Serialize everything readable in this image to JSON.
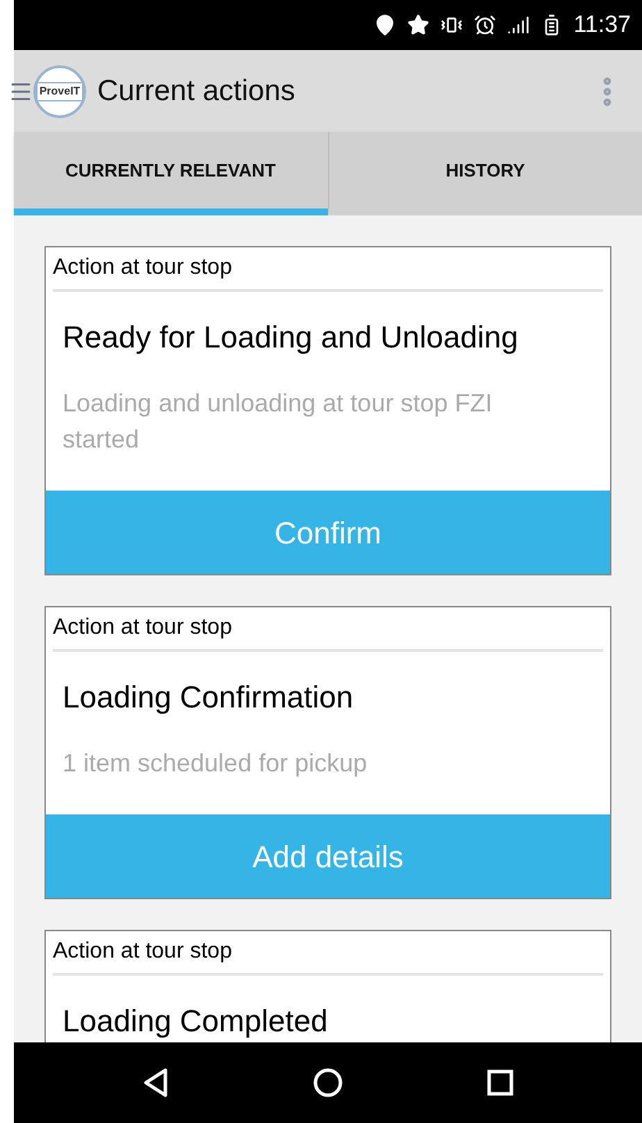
{
  "status_bar": {
    "time": "11:37"
  },
  "app_bar": {
    "logo_text": "ProveIT",
    "title": "Current actions"
  },
  "tabs": [
    {
      "label": "CURRENTLY RELEVANT",
      "selected": true
    },
    {
      "label": "HISTORY",
      "selected": false
    }
  ],
  "cards": [
    {
      "header": "Action at tour stop",
      "title": "Ready for Loading and Unloading",
      "description": "Loading and unloading at tour stop FZI started",
      "button": "Confirm"
    },
    {
      "header": "Action at tour stop",
      "title": "Loading Confirmation",
      "description": "1 item scheduled for pickup",
      "button": "Add details"
    },
    {
      "header": "Action at tour stop",
      "title": "Loading Completed"
    }
  ]
}
